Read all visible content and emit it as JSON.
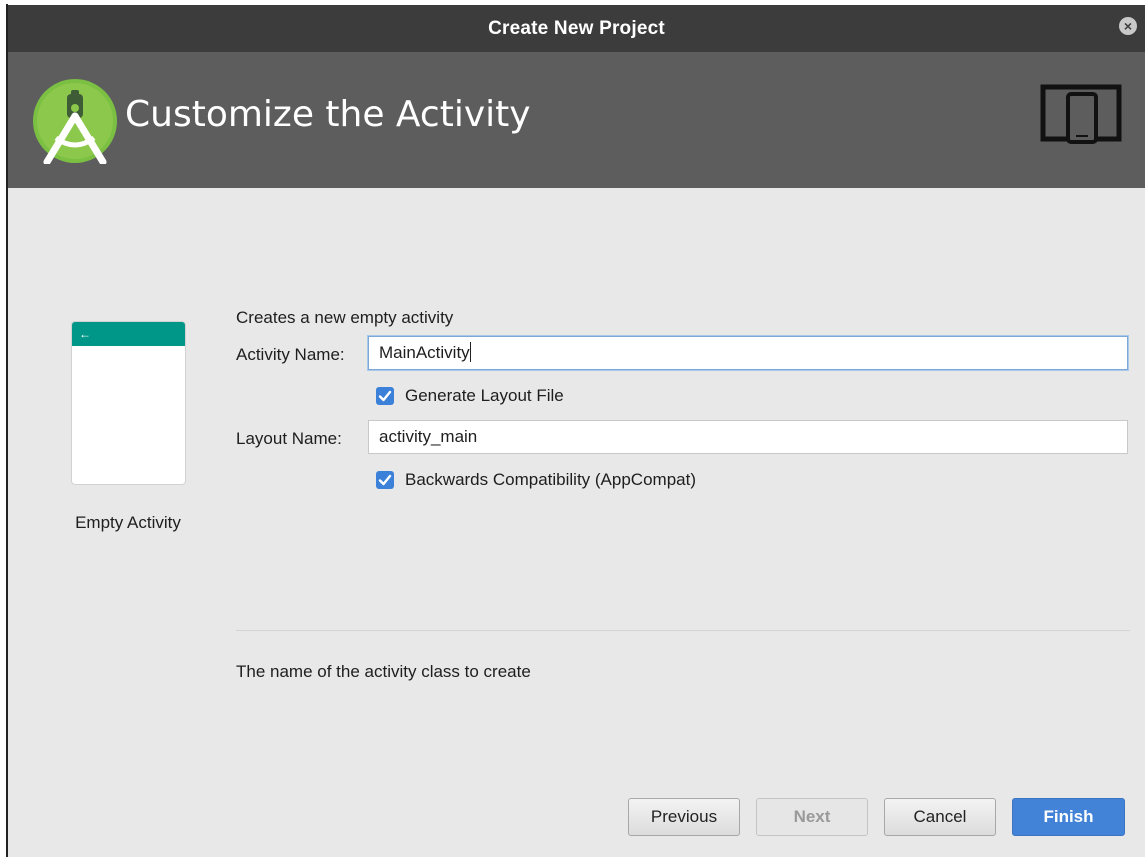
{
  "window": {
    "title": "Create New Project",
    "close_icon": "×"
  },
  "header": {
    "heading": "Customize the Activity",
    "logo_icon": "android-studio-logo-icon",
    "device_icon": "tablet-phone-icon"
  },
  "template": {
    "label": "Empty Activity",
    "back_arrow": "←"
  },
  "form": {
    "description": "Creates a new empty activity",
    "activity_name_label": "Activity Name:",
    "activity_name_value": "MainActivity",
    "generate_layout_label": "Generate Layout File",
    "generate_layout_checked": true,
    "layout_name_label": "Layout Name:",
    "layout_name_value": "activity_main",
    "backwards_compat_label": "Backwards Compatibility (AppCompat)",
    "backwards_compat_checked": true,
    "help_text": "The name of the activity class to create"
  },
  "buttons": {
    "previous": "Previous",
    "next": "Next",
    "cancel": "Cancel",
    "finish": "Finish"
  },
  "colors": {
    "accent": "#4283d8",
    "template_bar": "#009688",
    "header_bg": "#5d5d5d",
    "titlebar_bg": "#3c3c3c"
  }
}
